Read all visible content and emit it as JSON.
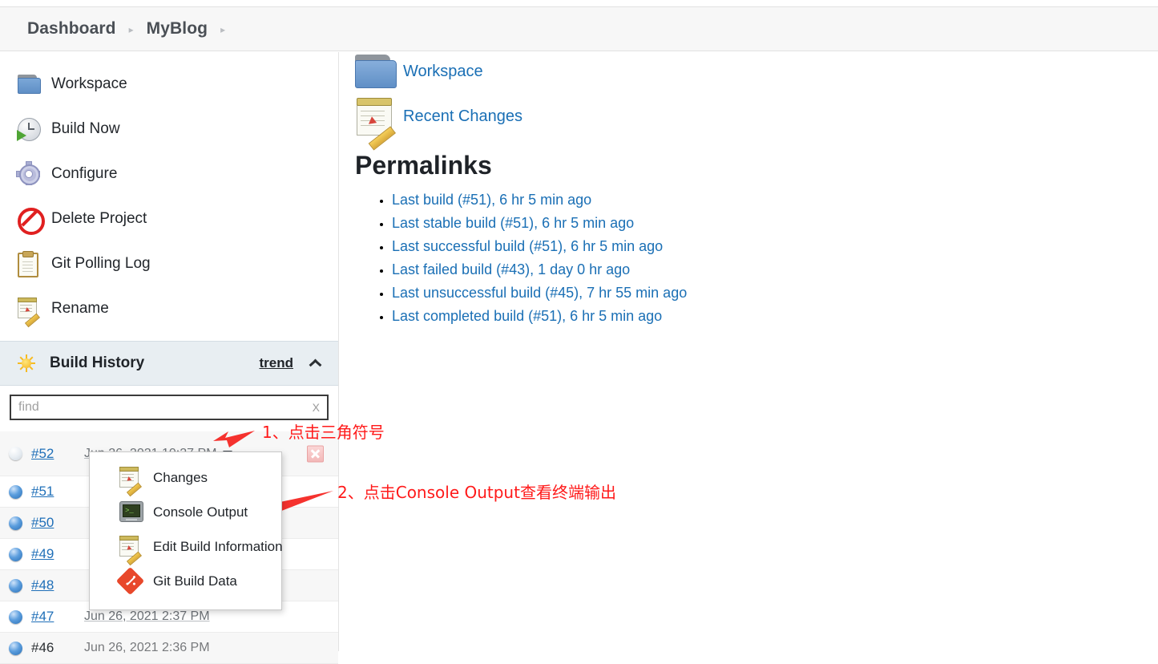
{
  "breadcrumb": {
    "items": [
      {
        "label": "Dashboard",
        "name": "breadcrumb-dashboard"
      },
      {
        "label": "MyBlog",
        "name": "breadcrumb-myblog"
      }
    ],
    "separator": "▸"
  },
  "sidebar": {
    "tasks": [
      {
        "label": "Workspace",
        "icon": "folder-icon"
      },
      {
        "label": "Build Now",
        "icon": "build-now-icon"
      },
      {
        "label": "Configure",
        "icon": "gear-icon"
      },
      {
        "label": "Delete Project",
        "icon": "delete-icon"
      },
      {
        "label": "Git Polling Log",
        "icon": "clipboard-icon"
      },
      {
        "label": "Rename",
        "icon": "notepad-pencil-icon"
      }
    ],
    "build_history": {
      "title": "Build History",
      "trend_label": "trend",
      "collapse_icon": "chevron-up-icon",
      "status_icon": "sun-icon",
      "find": {
        "value": "",
        "placeholder": "find",
        "clear_label": "X"
      },
      "rows": [
        {
          "number": "#52",
          "date": "Jun 26, 2021 10:27 PM",
          "status": "pending",
          "has_caret": true,
          "has_cancel": true,
          "date_link": true
        },
        {
          "number": "#51",
          "date": "",
          "status": "blue",
          "has_caret": false,
          "has_cancel": false,
          "date_link": true
        },
        {
          "number": "#50",
          "date": "",
          "status": "blue",
          "has_caret": false,
          "has_cancel": false,
          "date_link": true
        },
        {
          "number": "#49",
          "date": "",
          "status": "blue",
          "has_caret": false,
          "has_cancel": false,
          "date_link": true
        },
        {
          "number": "#48",
          "date": "",
          "status": "blue",
          "has_caret": false,
          "has_cancel": false,
          "date_link": true
        },
        {
          "number": "#47",
          "date": "Jun 26, 2021 2:37 PM",
          "status": "blue",
          "has_caret": false,
          "has_cancel": false,
          "date_link": true
        },
        {
          "number": "#46",
          "date": "Jun 26, 2021 2:36 PM",
          "status": "blue",
          "has_caret": false,
          "has_cancel": false,
          "date_link": false
        }
      ]
    }
  },
  "dropdown": {
    "items": [
      {
        "label": "Changes",
        "icon": "notepad-pencil-icon"
      },
      {
        "label": "Console Output",
        "icon": "console-icon"
      },
      {
        "label": "Edit Build Information",
        "icon": "notepad-pencil-icon"
      },
      {
        "label": "Git Build Data",
        "icon": "git-icon"
      }
    ]
  },
  "main": {
    "links": [
      {
        "label": "Workspace",
        "icon": "folder-icon"
      },
      {
        "label": "Recent Changes",
        "icon": "notepad-pencil-icon"
      }
    ],
    "permalinks_title": "Permalinks",
    "permalinks": [
      "Last build (#51), 6 hr 5 min ago",
      "Last stable build (#51), 6 hr 5 min ago",
      "Last successful build (#51), 6 hr 5 min ago",
      "Last failed build (#43), 1 day 0 hr ago",
      "Last unsuccessful build (#45), 7 hr 55 min ago",
      "Last completed build (#51), 6 hr 5 min ago"
    ]
  },
  "annotations": [
    {
      "text": "1、点击三角符号",
      "name": "annotation-step-1"
    },
    {
      "text": "2、点击Console Output查看终端输出",
      "name": "annotation-step-2"
    }
  ],
  "colors": {
    "link": "#1a6fb5",
    "annotation": "#ff1a1a",
    "build_history_bg": "#e8eef2",
    "breadcrumb_bg": "#f7f7f7"
  }
}
